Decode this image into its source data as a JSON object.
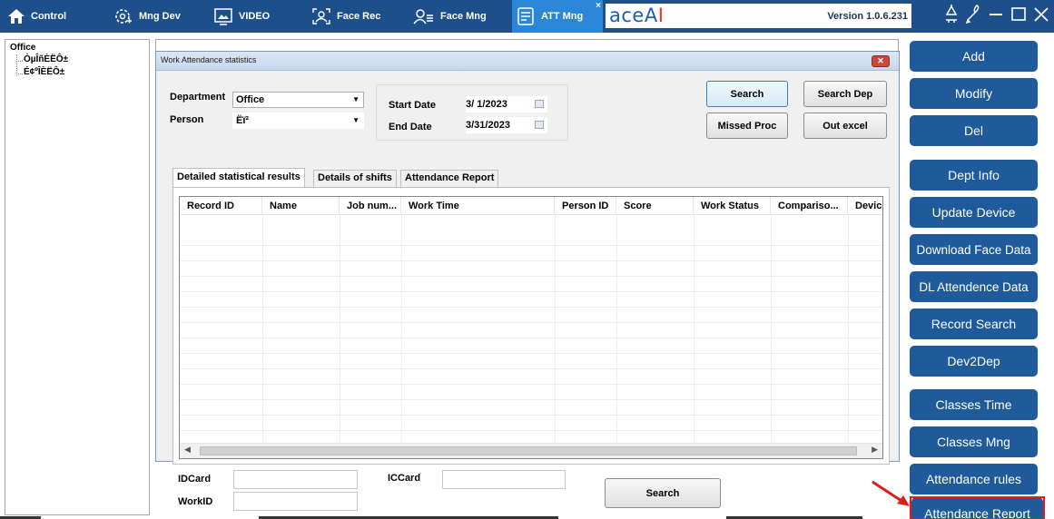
{
  "topbar": {
    "tabs": [
      {
        "label": "Control",
        "icon": "home-icon"
      },
      {
        "label": "Mng Dev",
        "icon": "device-settings-icon"
      },
      {
        "label": "VIDEO",
        "icon": "video-icon"
      },
      {
        "label": "Face Rec",
        "icon": "face-recognition-icon"
      },
      {
        "label": "Face Mng",
        "icon": "face-management-icon"
      },
      {
        "label": "ATT Mng",
        "icon": "attendance-icon",
        "active": true
      }
    ],
    "brand_pre": "aceA",
    "brand_i": "I",
    "version": "Version 1.0.6.231",
    "window_controls": [
      "pin-icon",
      "skin-icon",
      "minimize-icon",
      "maximize-icon",
      "close-icon"
    ]
  },
  "tree": {
    "root": "Office",
    "children": [
      "ÒµÎñÈËÔ±",
      "É¢ºÎÈËÔ±"
    ]
  },
  "right_buttons": [
    "Add",
    "Modify",
    "Del",
    "Dept Info",
    "Update Device",
    "Download Face Data",
    "DL Attendence Data",
    "Record Search",
    "Dev2Dep",
    "Classes Time",
    "Classes Mng",
    "Attendance rules",
    "Attendance Report"
  ],
  "dialog": {
    "title": "Work Attendance statistics",
    "department_label": "Department",
    "department_value": "Office",
    "person_label": "Person",
    "person_value": "Ëï²",
    "start_date_label": "Start Date",
    "start_date_value": "3/ 1/2023",
    "end_date_label": "End Date",
    "end_date_value": "3/31/2023",
    "search_button": "Search",
    "search_dep_button": "Search Dep",
    "missed_proc_button": "Missed Proc",
    "out_excel_button": "Out excel",
    "tabs": [
      "Detailed statistical results",
      "Details of shifts",
      "Attendance Report"
    ],
    "columns": [
      "Record ID",
      "Name",
      "Job num...",
      "Work Time",
      "Person ID",
      "Score",
      "Work Status",
      "Compariso...",
      "Device"
    ]
  },
  "bottom": {
    "idcard_label": "IDCard",
    "iccard_label": "ICCard",
    "workid_label": "WorkID",
    "search_button": "Search"
  },
  "colors": {
    "topbar_bg": "#1d4f8a",
    "active_tab_bg": "#2c86d8",
    "right_button_bg": "#1f5a9b",
    "annotation_red": "#e31b1b"
  }
}
